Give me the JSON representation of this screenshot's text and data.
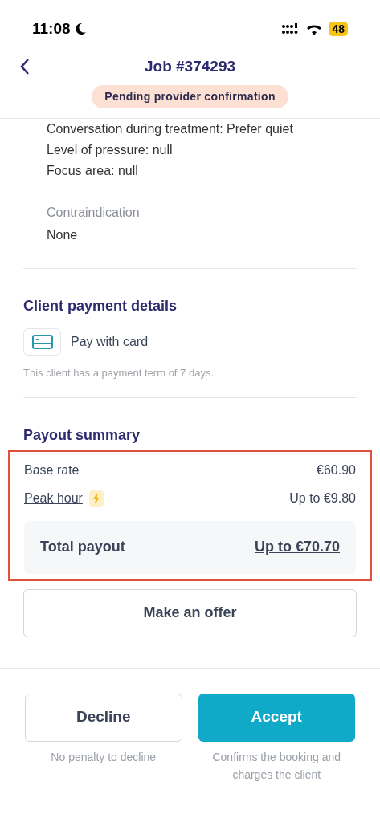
{
  "status_bar": {
    "time": "11:08",
    "battery": "48"
  },
  "header": {
    "title": "Job #374293",
    "status_badge": "Pending provider confirmation"
  },
  "details": {
    "lines": [
      "Conversation during treatment: Prefer quiet",
      "Level of pressure: null",
      "Focus area: null"
    ],
    "contraindication": {
      "label": "Contraindication",
      "value": "None"
    }
  },
  "client_payment": {
    "heading": "Client payment details",
    "method": "Pay with card",
    "note": "This client has a payment term of 7 days."
  },
  "payout_summary": {
    "heading": "Payout summary",
    "highlighted": true,
    "rows": [
      {
        "label": "Base rate",
        "value": "€60.90",
        "kind": "plain"
      },
      {
        "label": "Peak hour",
        "value": "Up to €9.80",
        "kind": "peak"
      }
    ],
    "total": {
      "label": "Total payout",
      "value": "Up to €70.70"
    }
  },
  "offer_button": "Make an offer",
  "actions": [
    {
      "label": "Decline",
      "caption": "No penalty to decline",
      "kind": "secondary"
    },
    {
      "label": "Accept",
      "caption": "Confirms the booking and charges the client",
      "kind": "primary"
    }
  ]
}
